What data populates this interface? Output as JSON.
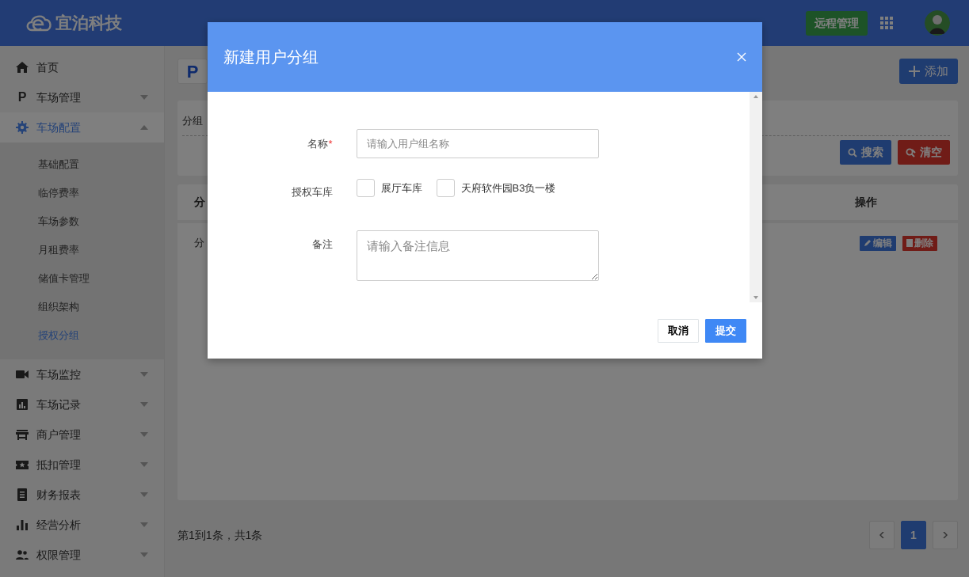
{
  "header": {
    "logo": "宜泊科技",
    "remote_button": "远程管理"
  },
  "sidebar": {
    "items": [
      {
        "label": "首页",
        "kind": "link",
        "selected": false
      },
      {
        "label": "车场管理",
        "glyph": "P",
        "kind": "group",
        "expanded": false,
        "selected": false
      },
      {
        "label": "车场配置",
        "kind": "group",
        "expanded": true,
        "selected": true,
        "children": [
          {
            "label": "基础配置",
            "selected": false
          },
          {
            "label": "临停费率",
            "selected": false
          },
          {
            "label": "车场参数",
            "selected": false
          },
          {
            "label": "月租费率",
            "selected": false
          },
          {
            "label": "储值卡管理",
            "selected": false
          },
          {
            "label": "组织架构",
            "selected": false
          },
          {
            "label": "授权分组",
            "selected": true
          }
        ]
      },
      {
        "label": "车场监控",
        "kind": "group",
        "expanded": false,
        "selected": false
      },
      {
        "label": "车场记录",
        "kind": "group",
        "expanded": false,
        "selected": false
      },
      {
        "label": "商户管理",
        "kind": "group",
        "expanded": false,
        "selected": false
      },
      {
        "label": "抵扣管理",
        "kind": "group",
        "expanded": false,
        "selected": false
      },
      {
        "label": "财务报表",
        "kind": "group",
        "expanded": false,
        "selected": false
      },
      {
        "label": "经营分析",
        "kind": "group",
        "expanded": false,
        "selected": false
      },
      {
        "label": "权限管理",
        "kind": "group",
        "expanded": false,
        "selected": false
      }
    ]
  },
  "page": {
    "breadcrumb": {
      "glyph": "P"
    },
    "add_button": "添加",
    "search": {
      "field_label": "分组",
      "search_button": "搜索",
      "clear_button": "清空"
    },
    "table": {
      "columns": [
        "分",
        "操作"
      ],
      "rows": [
        {
          "cells": [
            "分"
          ],
          "actions": [
            {
              "label": "编辑",
              "kind": "edit"
            },
            {
              "label": "删除",
              "kind": "delete"
            }
          ]
        }
      ]
    },
    "pagination": {
      "summary": "第1到1条，共1条",
      "pages": [
        {
          "label": "1",
          "selected": true
        }
      ]
    }
  },
  "modal": {
    "title": "新建用户分组",
    "fields": [
      {
        "kind": "text",
        "label": "名称",
        "required_mark": "*",
        "placeholder": "请输入用户组名称"
      },
      {
        "kind": "checkboxes",
        "label": "授权车库",
        "options": [
          {
            "label": "展厅车库",
            "checked": false
          },
          {
            "label": "天府软件园B3负一楼",
            "checked": false
          }
        ]
      },
      {
        "kind": "textarea",
        "label": "备注",
        "placeholder": "请输入备注信息"
      }
    ],
    "buttons": [
      {
        "label": "取消",
        "kind": "default"
      },
      {
        "label": "提交",
        "kind": "primary"
      }
    ]
  }
}
